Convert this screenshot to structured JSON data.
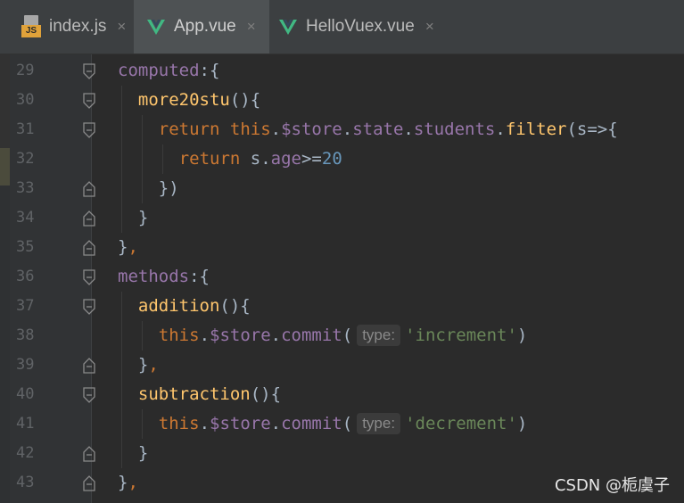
{
  "tabs": [
    {
      "label": "index.js",
      "icon": "js-file-icon",
      "active": false
    },
    {
      "label": "App.vue",
      "icon": "vue-file-icon",
      "active": true
    },
    {
      "label": "HelloVuex.vue",
      "icon": "vue-file-icon",
      "active": false
    }
  ],
  "close_glyph": "×",
  "colors": {
    "background": "#2b2b2b",
    "keyword": "#cc7832",
    "property": "#9876aa",
    "function": "#ffc66d",
    "number": "#6897bb",
    "string": "#6a8759",
    "vue_green": "#41b883"
  },
  "line_numbers": [
    "29",
    "30",
    "31",
    "32",
    "33",
    "34",
    "35",
    "36",
    "37",
    "38",
    "39",
    "40",
    "41",
    "42",
    "43"
  ],
  "code": [
    {
      "indent": 0,
      "tokens": [
        {
          "t": "computed",
          "c": "prop"
        },
        {
          "t": ":{",
          "c": "plain"
        }
      ]
    },
    {
      "indent": 1,
      "tokens": [
        {
          "t": "more20stu",
          "c": "fn"
        },
        {
          "t": "(){",
          "c": "plain"
        }
      ]
    },
    {
      "indent": 2,
      "tokens": [
        {
          "t": "return ",
          "c": "kw"
        },
        {
          "t": "this",
          "c": "kw"
        },
        {
          "t": ".",
          "c": "plain"
        },
        {
          "t": "$store",
          "c": "prop"
        },
        {
          "t": ".",
          "c": "plain"
        },
        {
          "t": "state",
          "c": "prop"
        },
        {
          "t": ".",
          "c": "plain"
        },
        {
          "t": "students",
          "c": "prop"
        },
        {
          "t": ".",
          "c": "plain"
        },
        {
          "t": "filter",
          "c": "fn"
        },
        {
          "t": "(s=>{",
          "c": "plain"
        }
      ]
    },
    {
      "indent": 3,
      "tokens": [
        {
          "t": "return ",
          "c": "kw"
        },
        {
          "t": "s.",
          "c": "plain"
        },
        {
          "t": "age",
          "c": "prop"
        },
        {
          "t": ">=",
          "c": "plain"
        },
        {
          "t": "20",
          "c": "num"
        }
      ]
    },
    {
      "indent": 2,
      "tokens": [
        {
          "t": "})",
          "c": "plain"
        }
      ]
    },
    {
      "indent": 1,
      "tokens": [
        {
          "t": "}",
          "c": "plain"
        }
      ]
    },
    {
      "indent": 0,
      "tokens": [
        {
          "t": "}",
          "c": "plain"
        },
        {
          "t": ",",
          "c": "kw"
        }
      ]
    },
    {
      "indent": 0,
      "tokens": [
        {
          "t": "methods",
          "c": "prop"
        },
        {
          "t": ":{",
          "c": "plain"
        }
      ]
    },
    {
      "indent": 1,
      "tokens": [
        {
          "t": "addition",
          "c": "fn"
        },
        {
          "t": "(){",
          "c": "plain"
        }
      ]
    },
    {
      "indent": 2,
      "tokens": [
        {
          "t": "this",
          "c": "kw"
        },
        {
          "t": ".",
          "c": "plain"
        },
        {
          "t": "$store",
          "c": "prop"
        },
        {
          "t": ".",
          "c": "plain"
        },
        {
          "t": "commit",
          "c": "prop"
        },
        {
          "t": "(",
          "c": "plain"
        },
        {
          "t": "type:",
          "c": "hint"
        },
        {
          "t": "'increment'",
          "c": "str"
        },
        {
          "t": ")",
          "c": "plain"
        }
      ]
    },
    {
      "indent": 1,
      "tokens": [
        {
          "t": "}",
          "c": "plain"
        },
        {
          "t": ",",
          "c": "kw"
        }
      ]
    },
    {
      "indent": 1,
      "tokens": [
        {
          "t": "subtraction",
          "c": "fn"
        },
        {
          "t": "(){",
          "c": "plain"
        }
      ]
    },
    {
      "indent": 2,
      "tokens": [
        {
          "t": "this",
          "c": "kw"
        },
        {
          "t": ".",
          "c": "plain"
        },
        {
          "t": "$store",
          "c": "prop"
        },
        {
          "t": ".",
          "c": "plain"
        },
        {
          "t": "commit",
          "c": "prop"
        },
        {
          "t": "(",
          "c": "plain"
        },
        {
          "t": "type:",
          "c": "hint"
        },
        {
          "t": "'decrement'",
          "c": "str"
        },
        {
          "t": ")",
          "c": "plain"
        }
      ]
    },
    {
      "indent": 1,
      "tokens": [
        {
          "t": "}",
          "c": "plain"
        }
      ]
    },
    {
      "indent": 0,
      "tokens": [
        {
          "t": "}",
          "c": "plain"
        },
        {
          "t": ",",
          "c": "kw"
        }
      ]
    }
  ],
  "fold_markers": [
    "open",
    "open",
    "open",
    "none",
    "close",
    "close",
    "close",
    "open",
    "open",
    "none",
    "close",
    "open",
    "none",
    "close",
    "close"
  ],
  "watermark": "CSDN @栀虞子"
}
